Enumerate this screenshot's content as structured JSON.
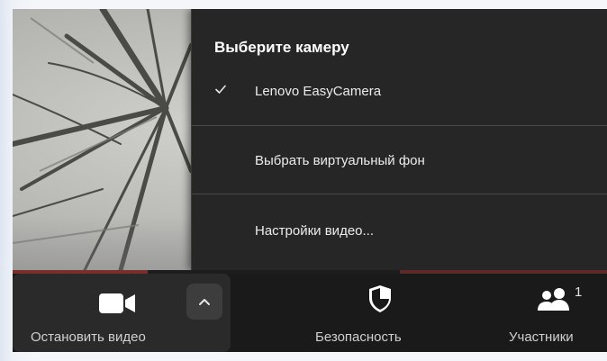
{
  "camera_menu": {
    "title": "Выберите камеру",
    "camera_item": "Lenovo EasyCamera",
    "camera_selected": true,
    "virtual_background_item": "Выбрать виртуальный фон",
    "video_settings_item": "Настройки видео..."
  },
  "toolbar": {
    "stop_video_label": "Остановить видео",
    "security_label": "Безопасность",
    "participants_label": "Участники",
    "participants_count": "1"
  },
  "colors": {
    "menu_background": "#262626",
    "toolbar_background": "#1a1a1a",
    "active_button_background": "#2a2a2a",
    "text": "#f2f2f2"
  },
  "icons": {
    "check": "check-icon",
    "video_camera": "video-camera-icon",
    "caret_up": "chevron-up-icon",
    "security": "shield-icon",
    "participants": "people-icon"
  }
}
